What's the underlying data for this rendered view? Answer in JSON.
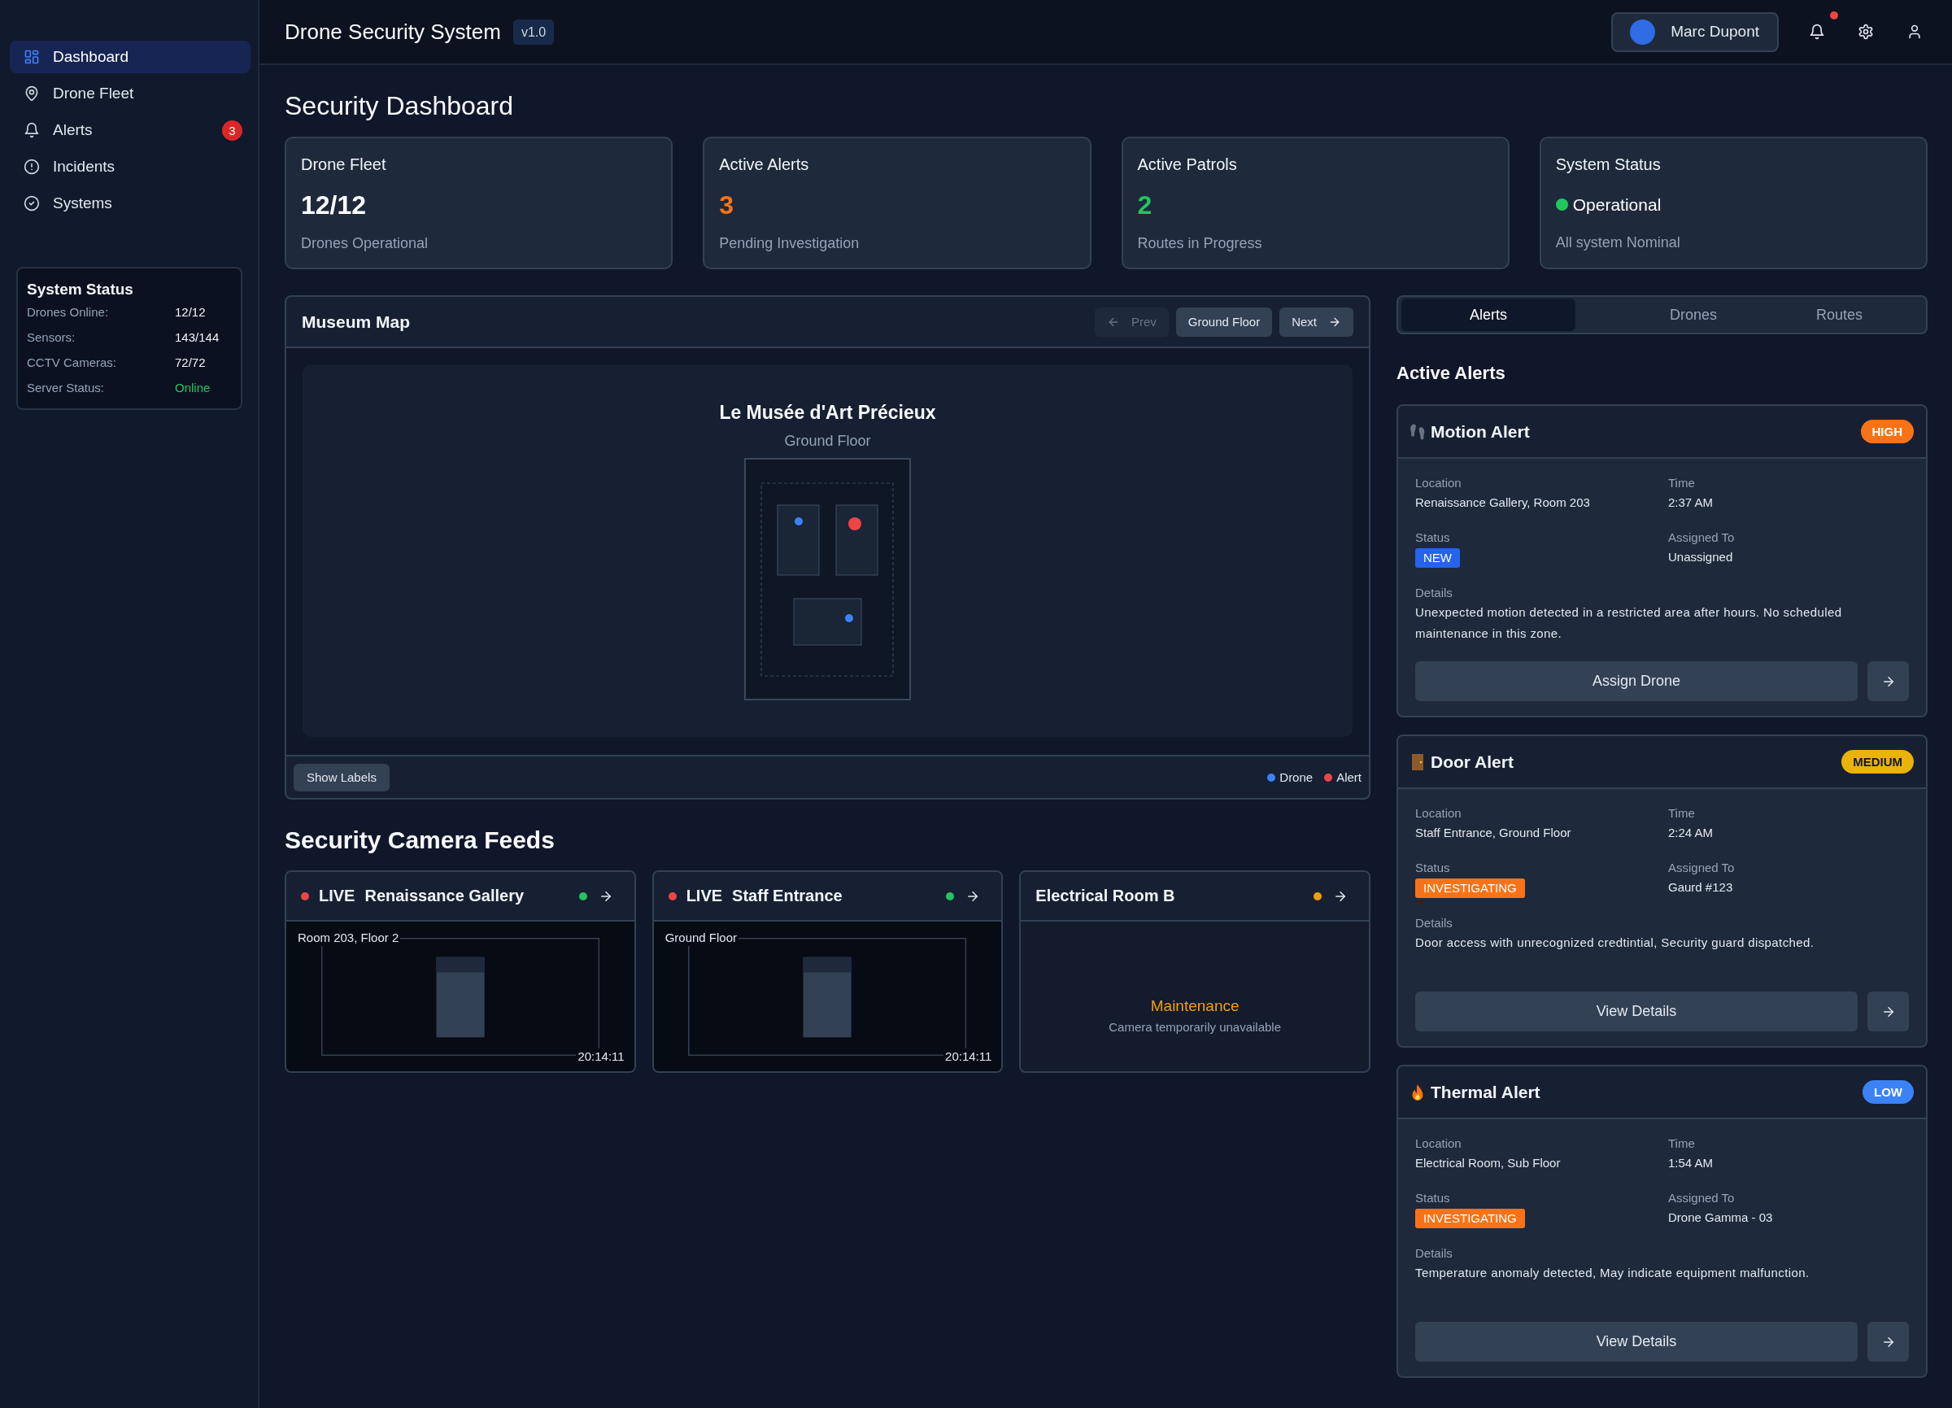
{
  "sidebar": {
    "nav_items": [
      {
        "label": "Dashboard",
        "selected": true
      },
      {
        "label": "Drone Fleet",
        "selected": false
      },
      {
        "label": "Alerts",
        "selected": false,
        "badge": "3"
      },
      {
        "label": "Incidents",
        "selected": false
      },
      {
        "label": "Systems",
        "selected": false
      }
    ],
    "status_panel": {
      "title": "System Status",
      "rows": [
        {
          "label": "Drones Online:",
          "value": "12/12",
          "kind": "count"
        },
        {
          "label": "Sensors:",
          "value": "143/144",
          "kind": "count"
        },
        {
          "label": "CCTV Cameras:",
          "value": "72/72",
          "kind": "count"
        },
        {
          "label": "Server Status:",
          "value": "Online",
          "kind": "status"
        }
      ]
    }
  },
  "header": {
    "title": "Drone Security System",
    "version": "v1.0",
    "user_name": "Marc Dupont",
    "has_unread": true
  },
  "page_title": "Security Dashboard",
  "stat_cards": [
    {
      "kind": "metric",
      "title": "Drone Fleet",
      "value": "12/12",
      "subtitle": "Drones Operational",
      "color": "#ffffff"
    },
    {
      "kind": "metric",
      "title": "Active Alerts",
      "value": "3",
      "subtitle": "Pending Investigation",
      "color": "#f97316"
    },
    {
      "kind": "metric",
      "title": "Active Patrols",
      "value": "2",
      "subtitle": "Routes in Progress",
      "color": "#22c55e"
    },
    {
      "kind": "status",
      "title": "System Status",
      "value": "Operational",
      "subtitle": "All system Nominal",
      "color": "#22c55e"
    }
  ],
  "map": {
    "title": "Museum Map",
    "prev": {
      "label": "Prev",
      "disabled": true
    },
    "floor_button": "Ground Floor",
    "next": {
      "label": "Next",
      "disabled": false
    },
    "building_name": "Le Musée d'Art Précieux",
    "floor_name": "Ground Floor",
    "rooms": [
      {
        "kind": "drone"
      },
      {
        "kind": "alert"
      },
      {
        "kind": "drone"
      }
    ],
    "labels_button": "Show Labels",
    "legend": [
      {
        "label": "Drone",
        "color": "#3b82f6"
      },
      {
        "label": "Alert",
        "color": "#ef4444"
      }
    ]
  },
  "cameras": {
    "title": "Security Camera Feeds",
    "feeds": [
      {
        "kind": "live",
        "live_tag": "LIVE",
        "name": "Renaissance Gallery",
        "color": "#22c55e",
        "location": "Room 203, Floor 2",
        "timestamp": "20:14:11"
      },
      {
        "kind": "live",
        "live_tag": "LIVE",
        "name": "Staff Entrance",
        "color": "#22c55e",
        "location": "Ground Floor",
        "timestamp": "20:14:11"
      },
      {
        "kind": "unavailable",
        "name": "Electrical Room B",
        "color": "#f59e0b",
        "message": "Maintenance",
        "note": "Camera temporarily unavailable"
      }
    ]
  },
  "right_panel": {
    "tabs": [
      {
        "label": "Alerts",
        "selected": true
      },
      {
        "label": "Drones",
        "selected": false
      },
      {
        "label": "Routes",
        "selected": false
      }
    ],
    "heading": "Active Alerts",
    "alerts": [
      {
        "kind": "motion",
        "title": "Motion Alert",
        "severity": {
          "label": "HIGH",
          "color": "#f97316"
        },
        "location_label": "Location",
        "location": "Renaissance Gallery, Room 203",
        "time_label": "Time",
        "time": "2:37 AM",
        "status_label": "Status",
        "status": {
          "label": "NEW",
          "color": "#2563eb"
        },
        "assigned_label": "Assigned To",
        "assigned": "Unassigned",
        "details_label": "Details",
        "details": "Unexpected motion detected in a restricted area after hours. No scheduled maintenance in this zone.",
        "action": "Assign Drone"
      },
      {
        "kind": "door",
        "title": "Door Alert",
        "severity": {
          "label": "MEDIUM",
          "color": "#eab308"
        },
        "location_label": "Location",
        "location": "Staff Entrance, Ground Floor",
        "time_label": "Time",
        "time": "2:24 AM",
        "status_label": "Status",
        "status": {
          "label": "INVESTIGATING",
          "color": "#f97316"
        },
        "assigned_label": "Assigned To",
        "assigned": "Gaurd #123",
        "details_label": "Details",
        "details": "Door access with unrecognized credtintial, Security guard dispatched.",
        "action": "View Details"
      },
      {
        "kind": "thermal",
        "title": "Thermal Alert",
        "severity": {
          "label": "LOW",
          "color": "#3b82f6"
        },
        "location_label": "Location",
        "location": "Electrical Room, Sub Floor",
        "time_label": "Time",
        "time": "1:54 AM",
        "status_label": "Status",
        "status": {
          "label": "INVESTIGATING",
          "color": "#f97316"
        },
        "assigned_label": "Assigned To",
        "assigned": "Drone Gamma - 03",
        "details_label": "Details",
        "details": "Temperature anomaly detected, May indicate equipment malfunction.",
        "action": "View Details"
      }
    ]
  }
}
